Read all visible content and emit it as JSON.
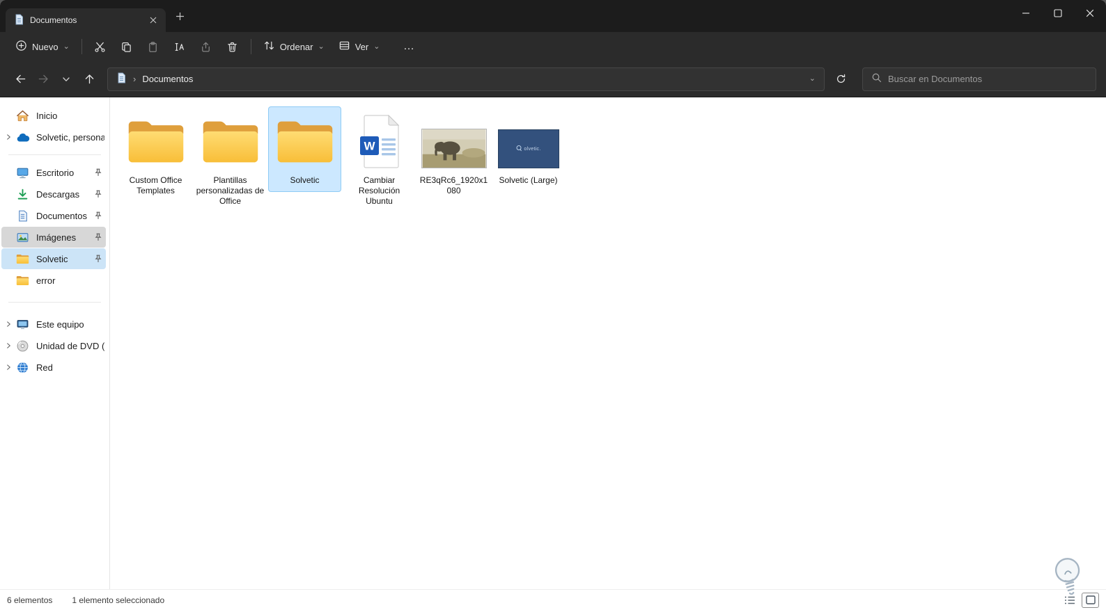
{
  "window": {
    "tab": {
      "title": "Documentos"
    }
  },
  "icons": {
    "more": "…",
    "breadcrumb_chevron": "›",
    "dropdown_chevron": "⌄",
    "word_glyph": "W"
  },
  "toolbar": {
    "new_label": "Nuevo",
    "sort_label": "Ordenar",
    "view_label": "Ver"
  },
  "address": {
    "location": "Documentos",
    "search_placeholder": "Buscar en Documentos"
  },
  "sidebar": {
    "items": [
      {
        "label": "Inicio"
      },
      {
        "label": "Solvetic, personal"
      },
      {
        "label": "Escritorio",
        "pinned": true
      },
      {
        "label": "Descargas",
        "pinned": true
      },
      {
        "label": "Documentos",
        "pinned": true
      },
      {
        "label": "Imágenes",
        "pinned": true,
        "selected": true
      },
      {
        "label": "Solvetic",
        "pinned": true,
        "highlighted": true
      },
      {
        "label": "error"
      },
      {
        "label": "Este equipo",
        "expandable": true
      },
      {
        "label": "Unidad de DVD (D:)",
        "expandable": true
      },
      {
        "label": "Red",
        "expandable": true
      }
    ]
  },
  "files": {
    "items": [
      {
        "name": "Custom Office Templates",
        "type": "folder"
      },
      {
        "name": "Plantillas personalizadas de Office",
        "type": "folder"
      },
      {
        "name": "Solvetic",
        "type": "folder",
        "selected": true
      },
      {
        "name": "Cambiar Resolución Ubuntu",
        "type": "word-document"
      },
      {
        "name": "RE3qRc6_1920x1080",
        "type": "image"
      },
      {
        "name": "Solvetic (Large)",
        "type": "image",
        "thumbnail_text": "olvetic."
      }
    ]
  },
  "statusbar": {
    "item_count": "6 elementos",
    "selection_status": "1 elemento seleccionado"
  }
}
